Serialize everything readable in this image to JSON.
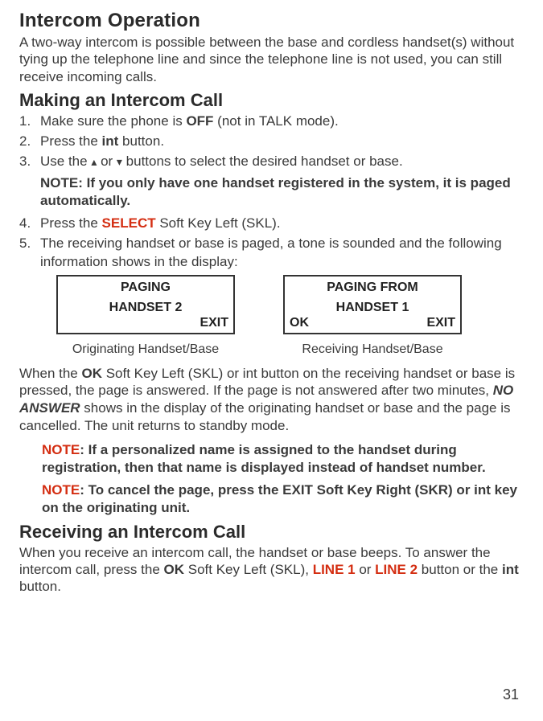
{
  "h1": "Intercom Operation",
  "intro": "A two-way intercom is possible between the base and cordless handset(s) without tying up the telephone line and since the telephone line is not used, you can still receive incoming calls.",
  "h2_making": "Making an Intercom Call",
  "steps": {
    "s1": {
      "num": "1.",
      "a": "Make sure the phone is ",
      "off": "OFF",
      "b": " (not in TALK mode)."
    },
    "s2": {
      "num": "2.",
      "a": "Press the ",
      "int": "int",
      "b": " button."
    },
    "s3": {
      "num": "3.",
      "a": "Use the ",
      "b": " or ",
      "c": " buttons to select the desired handset or base."
    },
    "s3_note": "NOTE: If you only have one handset registered in the system, it is paged automatically.",
    "s4": {
      "num": "4.",
      "a": "Press the ",
      "select": "SELECT",
      "b": " Soft Key Left (SKL)."
    },
    "s5": {
      "num": "5.",
      "text": "The receiving handset or base is paged, a tone is sounded and the following information shows in the display:"
    }
  },
  "display1": {
    "line1": "PAGING",
    "line2": "HANDSET 2",
    "br": "EXIT"
  },
  "display2": {
    "line1": "PAGING FROM",
    "line2": "HANDSET 1",
    "bl": "OK",
    "br": "EXIT"
  },
  "caption1": "Originating Handset/Base",
  "caption2": "Receiving Handset/Base",
  "para_ok": {
    "a": "When the ",
    "ok": "OK",
    "b": " Soft Key Left (SKL) or int button on the receiving handset or base is pressed, the page is answered. If the page is not answered after two minutes, ",
    "no_answer": "NO ANSWER",
    "c": " shows in the display of the originating handset or base and the page is cancelled. The unit returns to standby mode."
  },
  "note1": {
    "red": "NOTE",
    "text": ": If a personalized name is assigned to the handset during registration, then that name is displayed instead of handset number."
  },
  "note2": {
    "red": "NOTE",
    "text": ": To cancel the page, press the EXIT Soft Key Right (SKR) or int key on the originating unit."
  },
  "h2_receiving": "Receiving an Intercom Call",
  "para_recv": {
    "a": "When you receive an intercom call, the handset or base beeps. To answer the intercom call, press the ",
    "ok": "OK",
    "b": " Soft Key Left (SKL), ",
    "line1": "LINE 1",
    "or": " or ",
    "line2": "LINE 2",
    "c": " button or the ",
    "int": "int",
    "d": " button."
  },
  "page_num": "31"
}
